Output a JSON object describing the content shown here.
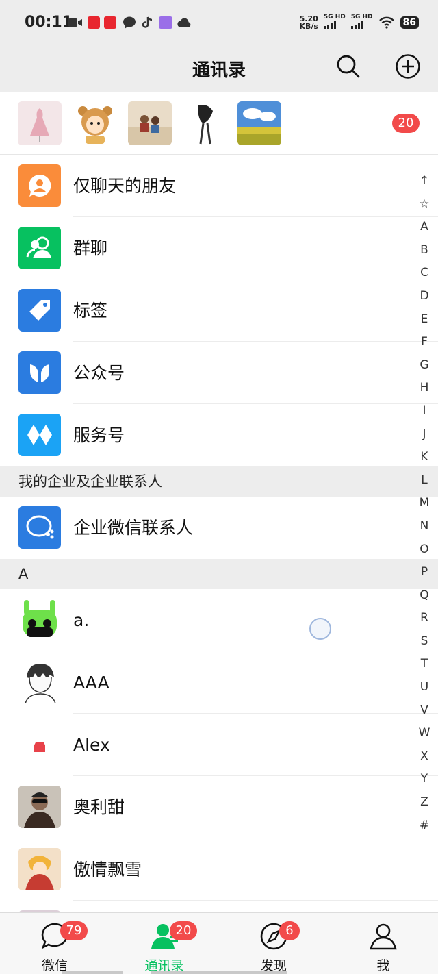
{
  "status_bar": {
    "time": "00:11",
    "speed_value": "5.20",
    "speed_unit": "KB/s",
    "net1": "5G HD",
    "net2": "5G HD",
    "battery": "86"
  },
  "nav": {
    "title": "通讯录",
    "search_icon": "search-icon",
    "add_icon": "plus-circle-icon"
  },
  "recent_contacts": {
    "badge": "20"
  },
  "menu": [
    {
      "label": "仅聊天的朋友",
      "color": "#fa8c3a",
      "icon": "chat-only-friend-icon"
    },
    {
      "label": "群聊",
      "color": "#07c160",
      "icon": "group-chat-icon"
    },
    {
      "label": "标签",
      "color": "#2b7ce0",
      "icon": "tag-icon"
    },
    {
      "label": "公众号",
      "color": "#2b7ce0",
      "icon": "official-account-icon"
    },
    {
      "label": "服务号",
      "color": "#1ba3f5",
      "icon": "service-account-icon"
    }
  ],
  "enterprise_section": {
    "header": "我的企业及企业联系人",
    "item": "企业微信联系人",
    "color": "#2b7ce0"
  },
  "section_a": {
    "header": "A",
    "contacts": [
      {
        "name": "a."
      },
      {
        "name": "AAA"
      },
      {
        "name": "Alex"
      },
      {
        "name": "奥利甜"
      },
      {
        "name": "傲情飘雪"
      }
    ]
  },
  "index_letters": [
    "↑",
    "☆",
    "A",
    "B",
    "C",
    "D",
    "E",
    "F",
    "G",
    "H",
    "I",
    "J",
    "K",
    "L",
    "M",
    "N",
    "O",
    "P",
    "Q",
    "R",
    "S",
    "T",
    "U",
    "V",
    "W",
    "X",
    "Y",
    "Z",
    "#"
  ],
  "tabs": [
    {
      "label": "微信",
      "badge": "79",
      "icon": "chat-bubble-icon"
    },
    {
      "label": "通讯录",
      "badge": "20",
      "icon": "contacts-icon"
    },
    {
      "label": "发现",
      "badge": "6",
      "icon": "compass-icon"
    },
    {
      "label": "我",
      "badge": "",
      "icon": "person-icon"
    }
  ],
  "colors": {
    "accent": "#07c160",
    "badge": "#f24a4a",
    "background": "#ededed"
  }
}
